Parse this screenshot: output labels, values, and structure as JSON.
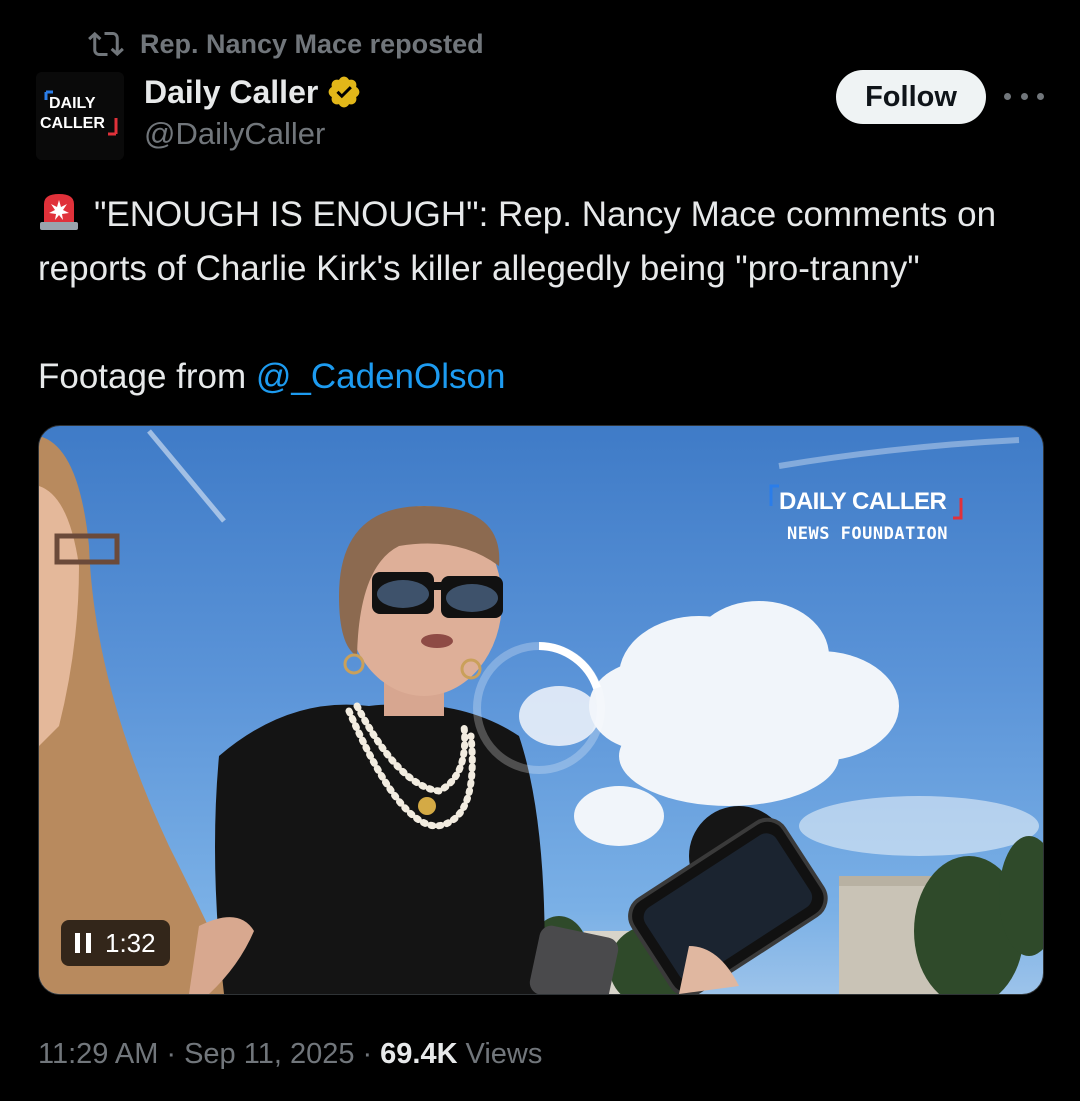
{
  "repost": {
    "label": "Rep. Nancy Mace reposted",
    "icon": "repost-icon"
  },
  "author": {
    "avatar_line1": "DAILY",
    "avatar_line2": "CALLER",
    "display_name": "Daily Caller",
    "handle": "@DailyCaller",
    "verified_icon": "verified-badge-icon",
    "verified_color": "#e2b719"
  },
  "actions": {
    "follow_label": "Follow",
    "more_icon": "more-icon"
  },
  "tweet": {
    "line1": "\"ENOUGH IS ENOUGH\": Rep. Nancy Mace comments on",
    "line2": "reports of Charlie Kirk's killer allegedly being \"pro-tranny\"",
    "footage_prefix": "Footage from ",
    "mention": "@_CadenOlson",
    "emoji_icon": "siren-icon"
  },
  "media": {
    "watermark_line1": "DAILY CALLER",
    "watermark_line2": "NEWS FOUNDATION",
    "duration": "1:32",
    "state_icon": "pause-icon"
  },
  "meta": {
    "time": "11:29 AM",
    "separator": "·",
    "date": "Sep 11, 2025",
    "views_count": "69.4K",
    "views_label": "Views"
  },
  "colors": {
    "background": "#000000",
    "text": "#e7e9ea",
    "muted": "#71767b",
    "link": "#1d9bf0",
    "brand_red": "#e0313a",
    "brand_blue": "#2b7de9"
  }
}
